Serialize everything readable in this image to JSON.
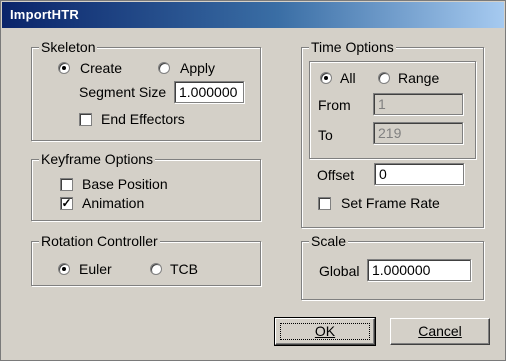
{
  "window": {
    "title": "ImportHTR"
  },
  "skeleton": {
    "legend": "Skeleton",
    "create_label": "Create",
    "apply_label": "Apply",
    "mode_selected": "Create",
    "segment_size_label": "Segment Size",
    "segment_size_value": "1.000000",
    "end_effectors_label": "End Effectors",
    "end_effectors_checked": false
  },
  "keyframe": {
    "legend": "Keyframe Options",
    "base_position_label": "Base Position",
    "base_position_checked": false,
    "animation_label": "Animation",
    "animation_checked": true
  },
  "rotation": {
    "legend": "Rotation Controller",
    "euler_label": "Euler",
    "tcb_label": "TCB",
    "selected": "Euler"
  },
  "time": {
    "legend": "Time Options",
    "all_label": "All",
    "range_label": "Range",
    "selected": "All",
    "from_label": "From",
    "from_value": "1",
    "to_label": "To",
    "to_value": "219",
    "offset_label": "Offset",
    "offset_value": "0",
    "set_frame_rate_label": "Set Frame Rate",
    "set_frame_rate_checked": false
  },
  "scale": {
    "legend": "Scale",
    "global_label": "Global",
    "global_value": "1.000000"
  },
  "buttons": {
    "ok_label": "OK",
    "cancel_label": "Cancel"
  },
  "colors": {
    "titlebar_start": "#0a246a",
    "titlebar_end": "#a6caf0",
    "dialog_bg": "#d4d0c8"
  }
}
